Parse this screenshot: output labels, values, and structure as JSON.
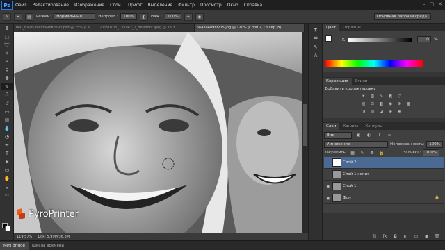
{
  "menubar": {
    "logo": "Ps",
    "items": [
      "Файл",
      "Редактирование",
      "Изображение",
      "Слои",
      "Шрифт",
      "Выделение",
      "Фильтр",
      "Просмотр",
      "Окно",
      "Справка"
    ],
    "controls": [
      "–",
      "□",
      "✕"
    ]
  },
  "options": {
    "mode_label": "Режим:",
    "mode_value": "Нормальный",
    "opacity_label": "Непрозр.:",
    "opacity_value": "100%",
    "flow_label": "Наж.:",
    "flow_value": "100%",
    "workspace": "Основная рабочая среда"
  },
  "tabs": [
    {
      "label": "IMG_6928-восстановлено.psd @ 25% (Ca...",
      "active": false
    },
    {
      "label": "20150705_135942_2_bestshot.jpeg @ 33,3...",
      "active": false
    },
    {
      "label": "5643a4898f775.jpg @ 120% (Слой 2, Гр.сер./8)",
      "active": true
    }
  ],
  "status": {
    "zoom": "119,57%",
    "doc": "Док: 5,99M/36,3M"
  },
  "bottom_tabs": [
    "Mini Bridge",
    "Шкала времени"
  ],
  "color_panel": {
    "tabs": [
      "Цвет",
      "Образцы"
    ],
    "channel": "K",
    "value": "0",
    "unit": "%"
  },
  "adjust_panel": {
    "tabs": [
      "Коррекция",
      "Стили"
    ],
    "title": "Добавить корректировку"
  },
  "layers_panel": {
    "tabs": [
      "Слои",
      "Каналы",
      "Контуры"
    ],
    "filter": "Вид",
    "blend": "Умножение",
    "opacity_label": "Непрозрачность:",
    "opacity_value": "100%",
    "lock_label": "Закрепить:",
    "fill_label": "Заливка:",
    "fill_value": "100%",
    "layers": [
      {
        "name": "Слой 2",
        "selected": true,
        "visible": false
      },
      {
        "name": "Слой 1 копия",
        "selected": false,
        "visible": false
      },
      {
        "name": "Слой 1",
        "selected": false,
        "visible": true
      },
      {
        "name": "Фон",
        "selected": false,
        "visible": true,
        "locked": true
      }
    ]
  },
  "watermark": "PyroPrinter"
}
